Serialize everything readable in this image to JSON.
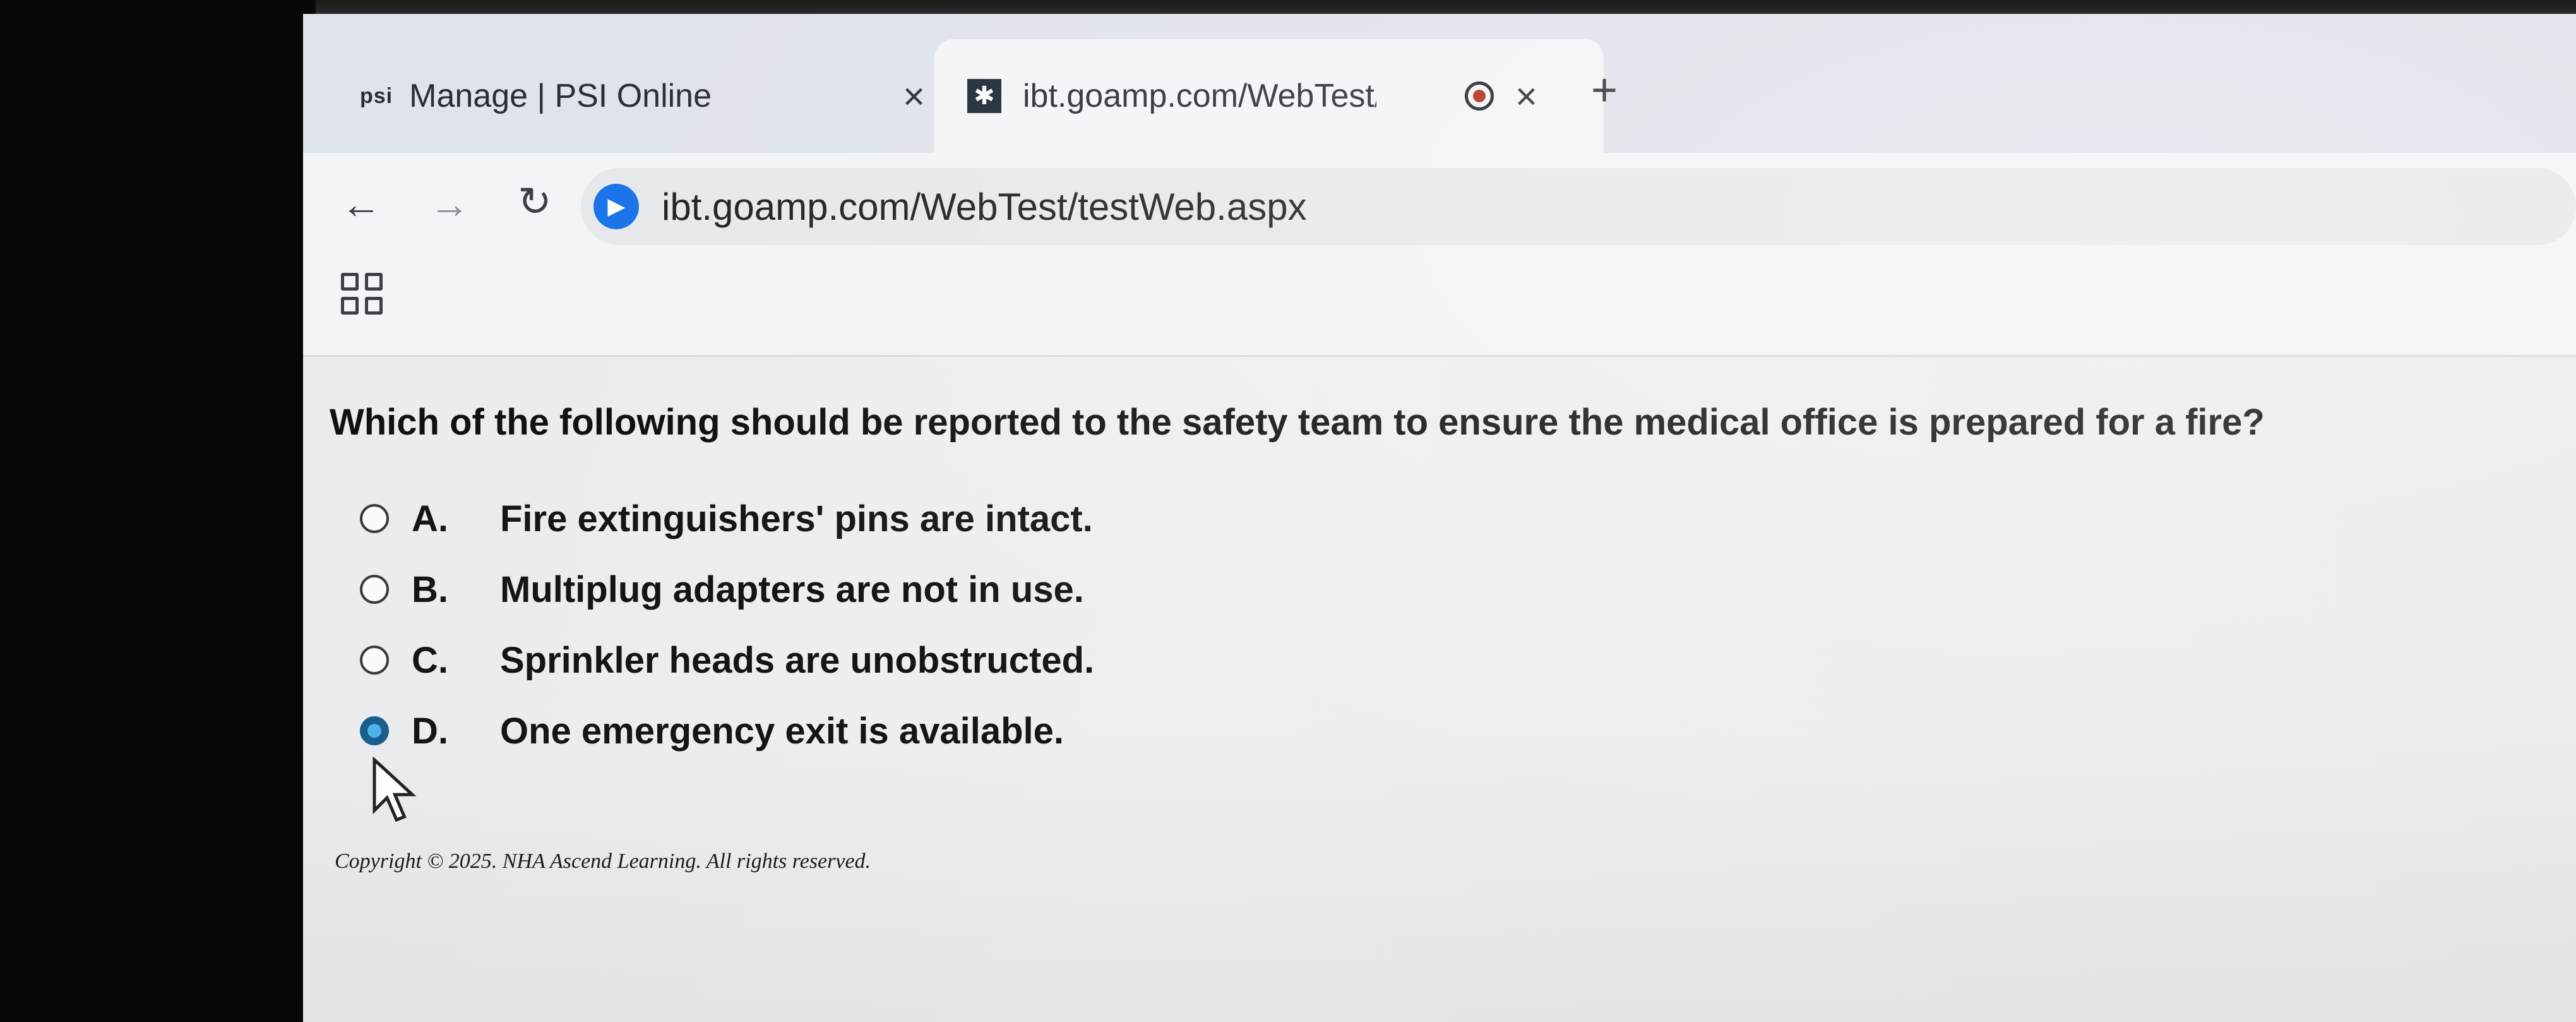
{
  "browser": {
    "tabs": [
      {
        "favicon": "psi",
        "title": "Manage | PSI Online",
        "active": false
      },
      {
        "favicon": "ibt-logo-icon",
        "title": "ibt.goamp.com/WebTest/te",
        "active": true,
        "recording": true
      }
    ],
    "new_tab": "+",
    "close_glyph": "×",
    "url": "ibt.goamp.com/WebTest/testWeb.aspx",
    "site_icon_glyph": "▶"
  },
  "test": {
    "question": "Which of the following should be reported to the safety team to ensure the medical office is prepared for a fire?",
    "options": [
      {
        "letter": "A.",
        "text": "Fire extinguishers' pins are intact.",
        "selected": false
      },
      {
        "letter": "B.",
        "text": "Multiplug adapters are not in use.",
        "selected": false
      },
      {
        "letter": "C.",
        "text": "Sprinkler heads are unobstructed.",
        "selected": false
      },
      {
        "letter": "D.",
        "text": "One emergency exit is available.",
        "selected": true
      }
    ],
    "copyright": "Copyright © 2025. NHA Ascend Learning. All rights reserved."
  },
  "colors": {
    "selected_radio": "#1a5d8f",
    "selected_radio_inner": "#4fb3e6",
    "site_icon": "#1a73e8"
  }
}
